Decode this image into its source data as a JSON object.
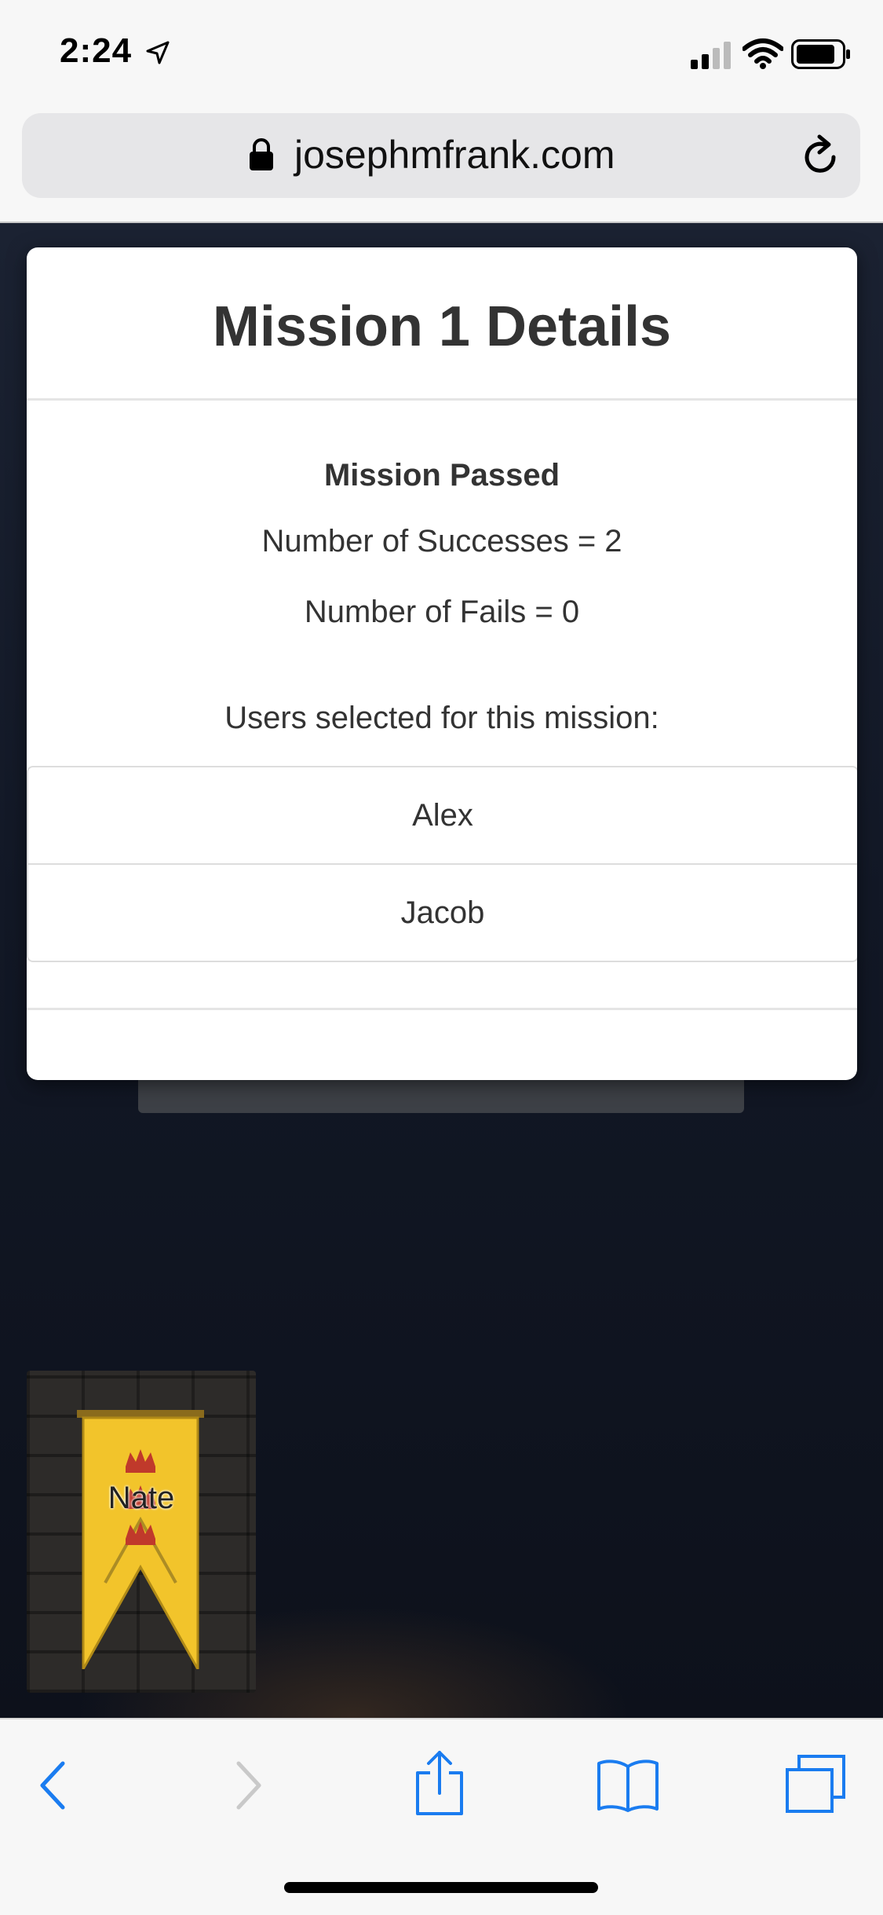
{
  "status_bar": {
    "time": "2:24"
  },
  "browser": {
    "url": "josephmfrank.com"
  },
  "modal": {
    "title": "Mission 1 Details",
    "result": "Mission Passed",
    "successes": "Number of Successes = 2",
    "fails": "Number of Fails = 0",
    "users_heading": "Users selected for this mission:",
    "users": [
      "Alex",
      "Jacob"
    ]
  },
  "player_card": {
    "name": "Nate"
  },
  "colors": {
    "accent": "#1a7cf0",
    "banner": "#f2c42b",
    "crown": "#c0392b"
  },
  "toolbar": {
    "icons": [
      "back-icon",
      "forward-icon",
      "share-icon",
      "bookmarks-icon",
      "tabs-icon"
    ]
  }
}
